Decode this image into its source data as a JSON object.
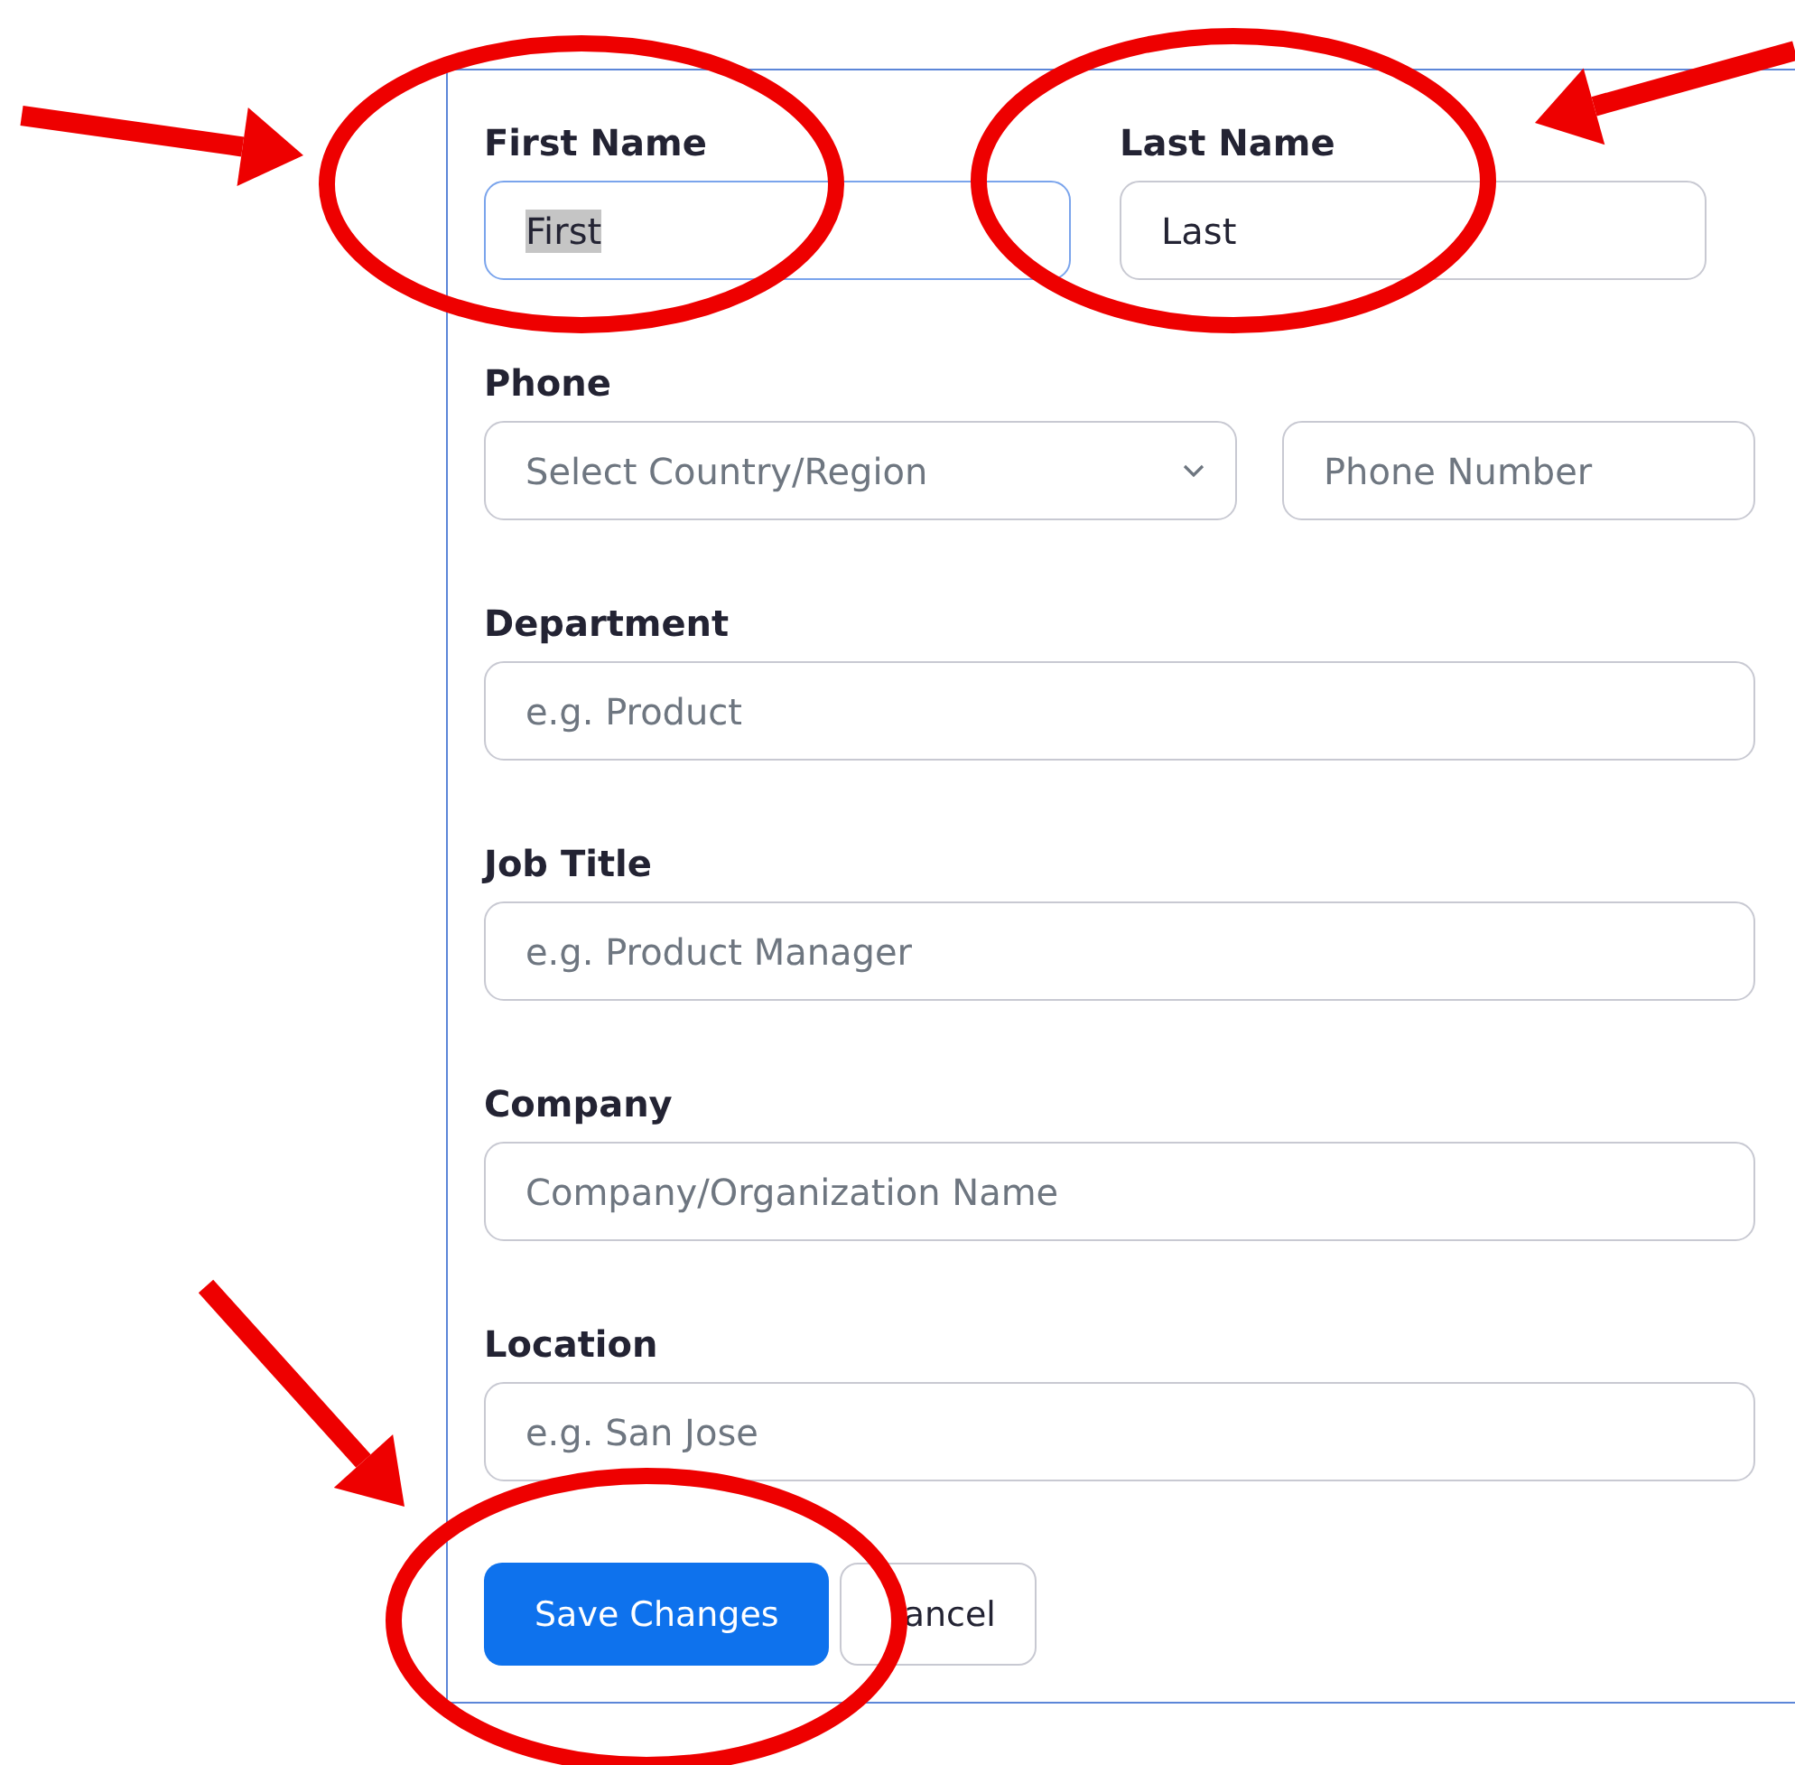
{
  "form": {
    "rows": [
      {
        "fields": [
          {
            "label": "First Name",
            "kind": "text",
            "value": "First",
            "focused": true
          },
          {
            "label": "Last Name",
            "kind": "text",
            "value": "Last",
            "focused": false
          }
        ]
      },
      {
        "label": "Phone",
        "fields": [
          {
            "kind": "select",
            "placeholder": "Select Country/Region",
            "focused": false
          },
          {
            "kind": "text",
            "placeholder": "Phone Number",
            "focused": false
          }
        ]
      },
      {
        "label": "Department",
        "fields": [
          {
            "kind": "text",
            "placeholder": "e.g. Product",
            "focused": false
          }
        ]
      },
      {
        "label": "Job Title",
        "fields": [
          {
            "kind": "text",
            "placeholder": "e.g. Product Manager",
            "focused": false
          }
        ]
      },
      {
        "label": "Company",
        "fields": [
          {
            "kind": "text",
            "placeholder": "Company/Organization Name",
            "focused": false
          }
        ]
      },
      {
        "label": "Location",
        "fields": [
          {
            "kind": "text",
            "placeholder": "e.g. San Jose",
            "focused": false
          }
        ]
      }
    ],
    "buttons": [
      {
        "label": "Save Changes",
        "kind": "primary"
      },
      {
        "label": "ancel",
        "kind": "secondary"
      }
    ]
  },
  "annotations": [
    {
      "kind": "ellipse"
    },
    {
      "kind": "ellipse"
    },
    {
      "kind": "ellipse"
    },
    {
      "kind": "arrow"
    },
    {
      "kind": "arrow"
    },
    {
      "kind": "arrow"
    }
  ]
}
